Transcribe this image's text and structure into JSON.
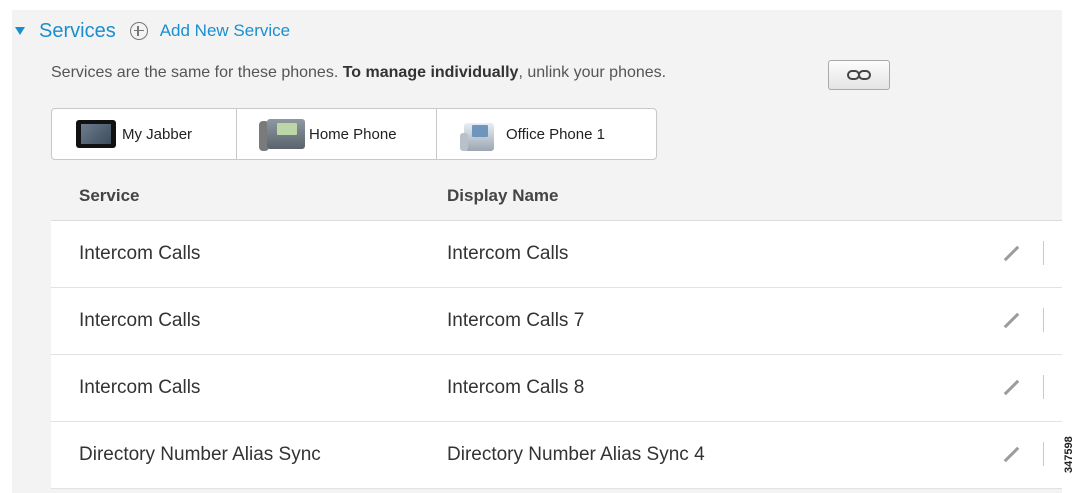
{
  "header": {
    "title": "Services",
    "add_link": "Add New Service"
  },
  "notice": {
    "prefix": "Services are the same for these phones. ",
    "bold": "To manage individually",
    "suffix": ", unlink your phones."
  },
  "device_tabs": [
    {
      "label": "My Jabber",
      "icon": "tablet-icon"
    },
    {
      "label": "Home Phone",
      "icon": "desk-phone-icon"
    },
    {
      "label": "Office Phone 1",
      "icon": "ip-phone-icon"
    }
  ],
  "table": {
    "columns": [
      "Service",
      "Display Name"
    ],
    "rows": [
      {
        "service": "Intercom Calls",
        "display_name": "Intercom Calls"
      },
      {
        "service": "Intercom Calls",
        "display_name": "Intercom Calls 7"
      },
      {
        "service": "Intercom Calls",
        "display_name": "Intercom Calls 8"
      },
      {
        "service": "Directory Number Alias Sync",
        "display_name": "Directory Number Alias Sync 4"
      }
    ]
  },
  "figure_id": "347598",
  "colors": {
    "accent": "#1a8fd0",
    "panel_background": "#f3f3f3"
  }
}
